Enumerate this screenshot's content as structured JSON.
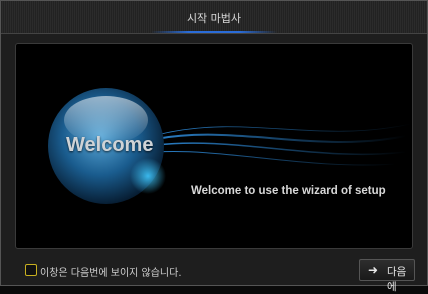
{
  "window": {
    "title": "시작 마법사"
  },
  "content": {
    "welcome_word": "Welcome",
    "tagline": "Welcome to use the wizard of setup"
  },
  "footer": {
    "checkbox_label": "이창은 다음번에 보이지 않습니다.",
    "checkbox_checked": false,
    "next_icon": "right-arrow-icon",
    "next_arrow_glyph": "➜",
    "next_label": "다음에"
  },
  "colors": {
    "accent_blue": "#2a6cd8",
    "checkbox_border": "#c8b020"
  }
}
